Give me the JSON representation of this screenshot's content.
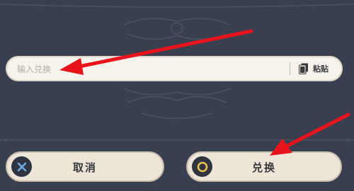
{
  "redeem_dialog": {
    "code_input": {
      "placeholder": "输入兑换",
      "value": ""
    },
    "paste_button": {
      "label": "粘贴",
      "icon": "clipboard-icon"
    },
    "cancel_button": {
      "label": "取消",
      "icon": "cross-circle-icon",
      "icon_color": "#6fa8e6"
    },
    "confirm_button": {
      "label": "兑换",
      "icon": "ring-circle-icon",
      "icon_color": "#e8c24a"
    }
  },
  "annotations": {
    "arrow_color": "#e8131b",
    "arrow_count": 2
  },
  "theme": {
    "background": "#3a3f4f",
    "panel": "#f6f3ec",
    "button_fill": "#ece5d8"
  }
}
